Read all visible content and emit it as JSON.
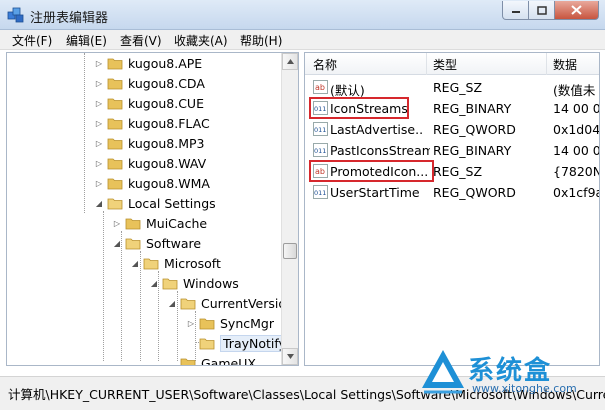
{
  "window": {
    "title": "注册表编辑器"
  },
  "menu": [
    "文件(F)",
    "编辑(E)",
    "查看(V)",
    "收藏夹(A)",
    "帮助(H)"
  ],
  "tree": [
    {
      "label": "kugou8.APE",
      "expander": "▷"
    },
    {
      "label": "kugou8.CDA",
      "expander": "▷"
    },
    {
      "label": "kugou8.CUE",
      "expander": "▷"
    },
    {
      "label": "kugou8.FLAC",
      "expander": "▷"
    },
    {
      "label": "kugou8.MP3",
      "expander": "▷"
    },
    {
      "label": "kugou8.WAV",
      "expander": "▷"
    },
    {
      "label": "kugou8.WMA",
      "expander": "▷"
    },
    {
      "label": "Local Settings",
      "expander": "◢"
    },
    {
      "label": "MuiCache",
      "expander": "▷"
    },
    {
      "label": "Software",
      "expander": "◢"
    },
    {
      "label": "Microsoft",
      "expander": "◢"
    },
    {
      "label": "Windows",
      "expander": "◢"
    },
    {
      "label": "CurrentVersion",
      "expander": "◢"
    },
    {
      "label": "SyncMgr",
      "expander": "▷"
    },
    {
      "label": "TrayNotify",
      "expander": "",
      "selected": true
    },
    {
      "label": "GameUX",
      "expander": ""
    }
  ],
  "list": {
    "columns": [
      "名称",
      "类型",
      "数据"
    ],
    "rows": [
      {
        "name": "(默认)",
        "type": "REG_SZ",
        "data": "(数值未",
        "icon": "string-value-icon",
        "icon_text": "ab"
      },
      {
        "name": "IconStreams",
        "type": "REG_BINARY",
        "data": "14 00 0",
        "icon": "binary-value-icon",
        "icon_text": "011",
        "highlight": true
      },
      {
        "name": "LastAdvertise...",
        "type": "REG_QWORD",
        "data": "0x1d04",
        "icon": "binary-value-icon",
        "icon_text": "011"
      },
      {
        "name": "PastIconsStream",
        "type": "REG_BINARY",
        "data": "14 00 0",
        "icon": "binary-value-icon",
        "icon_text": "011"
      },
      {
        "name": "PromotedIcon...",
        "type": "REG_SZ",
        "data": "{7820N",
        "icon": "string-value-icon",
        "icon_text": "ab",
        "highlight": true
      },
      {
        "name": "UserStartTime",
        "type": "REG_QWORD",
        "data": "0x1cf9a",
        "icon": "binary-value-icon",
        "icon_text": "011"
      }
    ]
  },
  "status": {
    "path": "计算机\\HKEY_CURRENT_USER\\Software\\Classes\\Local Settings\\Software\\Microsoft\\Windows\\Curre"
  },
  "watermark": {
    "brand": "系统盒",
    "url": "www.xitonghe.com"
  },
  "colors": {
    "folder": "#e8c25a",
    "highlight": "#d6282d",
    "brand": "#1e90d6"
  }
}
